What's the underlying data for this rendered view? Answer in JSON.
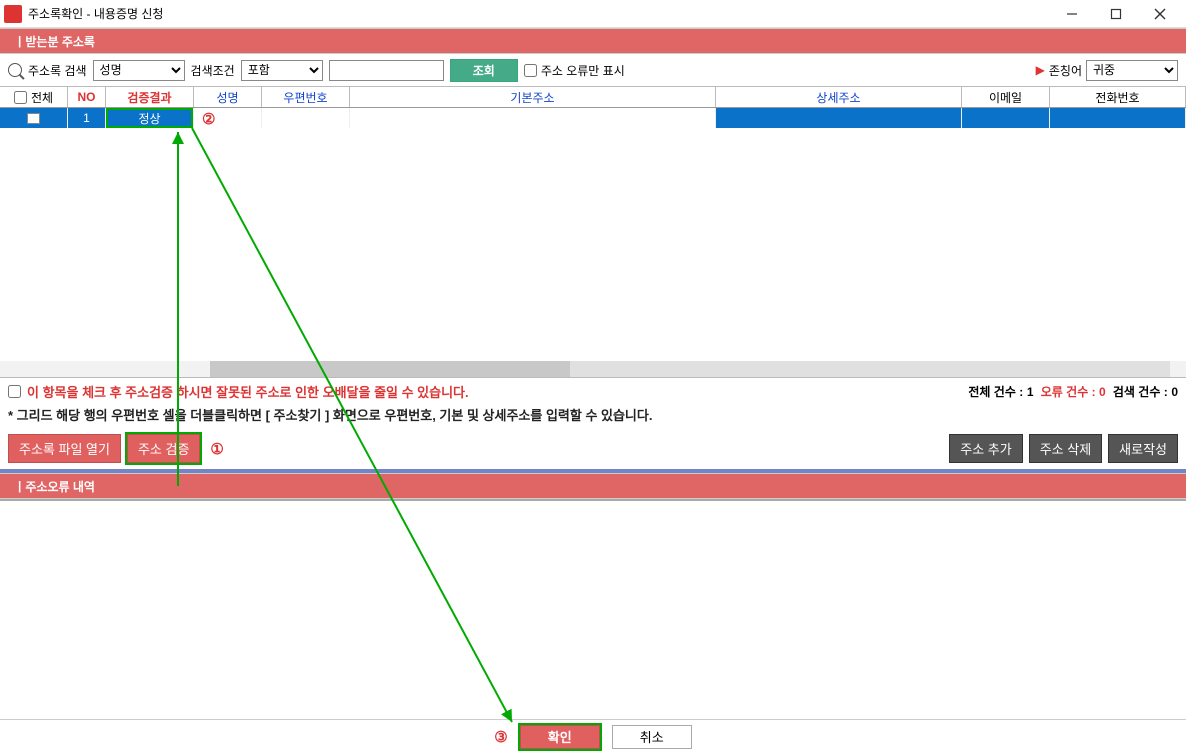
{
  "window": {
    "title": "주소록확인 - 내용증명 신청",
    "app_icon_text": ""
  },
  "header_recipient": "받는분 주소록",
  "search": {
    "label": "주소록 검색",
    "field_options_selected": "성명",
    "cond_label": "검색조건",
    "cond_selected": "포함",
    "query_value": "",
    "search_btn": "조회",
    "errors_only_label": "주소 오류만 표시",
    "honorific_label": "존칭어",
    "honorific_selected": "귀중"
  },
  "columns": {
    "all": "전체",
    "no": "NO",
    "result": "검증결과",
    "name": "성명",
    "zip": "우편번호",
    "base_addr": "기본주소",
    "detail_addr": "상세주소",
    "email": "이메일",
    "phone": "전화번호"
  },
  "rows": [
    {
      "no": "1",
      "result": "정상",
      "name": "",
      "zip": "",
      "base_addr": "",
      "detail_addr": "",
      "email": "",
      "phone": ""
    }
  ],
  "info": {
    "warn_text": "이 항목을 체크 후 주소검증 하시면 잘못된 주소로 인한 오배달을 줄일 수 있습니다.",
    "tip_text": "* 그리드 해당 행의 우편번호 셀을 더블클릭하면 [ 주소찾기 ] 화면으로 우편번호, 기본 및 상세주소를 입력할 수 있습니다.",
    "count_total_label": "전체 건수 :",
    "count_total": "1",
    "count_error_label": "오류 건수 :",
    "count_error": "0",
    "count_search_label": "검색 건수 :",
    "count_search": "0"
  },
  "actions": {
    "open_file": "주소록 파일 열기",
    "verify": "주소 검증",
    "add": "주소 추가",
    "del": "주소 삭제",
    "new": "새로작성"
  },
  "header_error": "주소오류 내역",
  "bottom": {
    "confirm": "확인",
    "cancel": "취소"
  },
  "annotations": {
    "m1": "①",
    "m2": "②",
    "m3": "③"
  }
}
